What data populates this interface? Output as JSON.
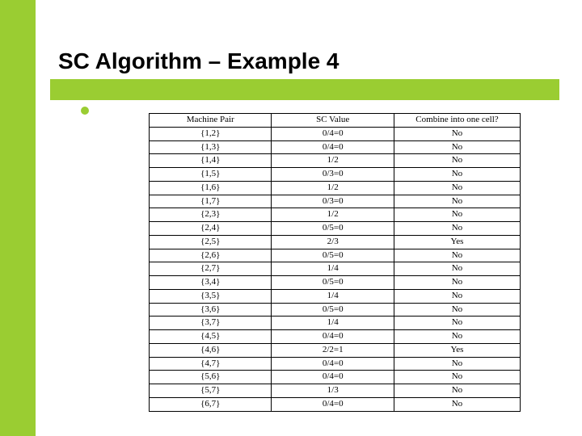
{
  "title": "SC Algorithm – Example 4",
  "headers": {
    "pair": "Machine Pair",
    "scv": "SC Value",
    "combine": "Combine into one cell?"
  },
  "rows": [
    {
      "pair": "{1,2}",
      "scv": "0/4=0",
      "combine": "No"
    },
    {
      "pair": "{1,3}",
      "scv": "0/4=0",
      "combine": "No"
    },
    {
      "pair": "{1,4}",
      "scv": "1/2",
      "combine": "No"
    },
    {
      "pair": "{1,5}",
      "scv": "0/3=0",
      "combine": "No"
    },
    {
      "pair": "{1,6}",
      "scv": "1/2",
      "combine": "No"
    },
    {
      "pair": "{1,7}",
      "scv": "0/3=0",
      "combine": "No"
    },
    {
      "pair": "{2,3}",
      "scv": "1/2",
      "combine": "No"
    },
    {
      "pair": "{2,4}",
      "scv": "0/5=0",
      "combine": "No"
    },
    {
      "pair": "{2,5}",
      "scv": "2/3",
      "combine": "Yes"
    },
    {
      "pair": "{2,6}",
      "scv": "0/5=0",
      "combine": "No"
    },
    {
      "pair": "{2,7}",
      "scv": "1/4",
      "combine": "No"
    },
    {
      "pair": "{3,4}",
      "scv": "0/5=0",
      "combine": "No"
    },
    {
      "pair": "{3,5}",
      "scv": "1/4",
      "combine": "No"
    },
    {
      "pair": "{3,6}",
      "scv": "0/5=0",
      "combine": "No"
    },
    {
      "pair": "{3,7}",
      "scv": "1/4",
      "combine": "No"
    },
    {
      "pair": "{4,5}",
      "scv": "0/4=0",
      "combine": "No"
    },
    {
      "pair": "{4,6}",
      "scv": "2/2=1",
      "combine": "Yes"
    },
    {
      "pair": "{4,7}",
      "scv": "0/4=0",
      "combine": "No"
    },
    {
      "pair": "{5,6}",
      "scv": "0/4=0",
      "combine": "No"
    },
    {
      "pair": "{5,7}",
      "scv": "1/3",
      "combine": "No"
    },
    {
      "pair": "{6,7}",
      "scv": "0/4=0",
      "combine": "No"
    }
  ]
}
